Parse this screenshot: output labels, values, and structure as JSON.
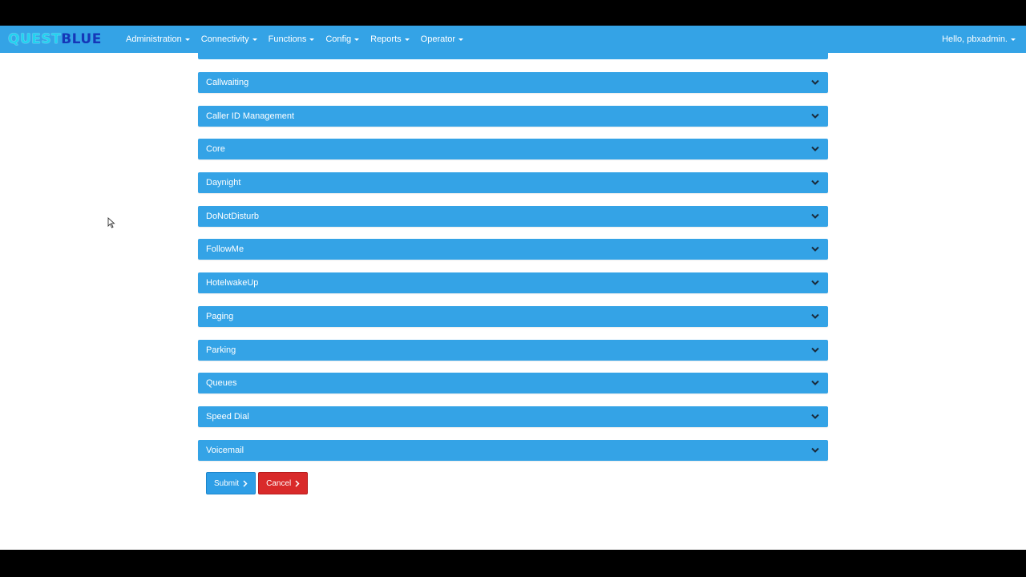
{
  "brand": {
    "part1": "QUEST",
    "part2": "BLUE"
  },
  "nav": {
    "items": [
      {
        "label": "Administration"
      },
      {
        "label": "Connectivity"
      },
      {
        "label": "Functions"
      },
      {
        "label": "Config"
      },
      {
        "label": "Reports"
      },
      {
        "label": "Operator"
      }
    ],
    "user_label": "Hello, pbxadmin."
  },
  "panels": [
    {
      "title": "Callwaiting"
    },
    {
      "title": "Caller ID Management"
    },
    {
      "title": "Core"
    },
    {
      "title": "Daynight"
    },
    {
      "title": "DoNotDisturb"
    },
    {
      "title": "FollowMe"
    },
    {
      "title": "HotelwakeUp"
    },
    {
      "title": "Paging"
    },
    {
      "title": "Parking"
    },
    {
      "title": "Queues"
    },
    {
      "title": "Speed Dial"
    },
    {
      "title": "Voicemail"
    }
  ],
  "buttons": {
    "submit": "Submit",
    "cancel": "Cancel"
  },
  "colors": {
    "navbar": "#34a3e6",
    "panel": "#34a3e6",
    "submit": "#2e9ee6",
    "cancel": "#d92a2a"
  }
}
